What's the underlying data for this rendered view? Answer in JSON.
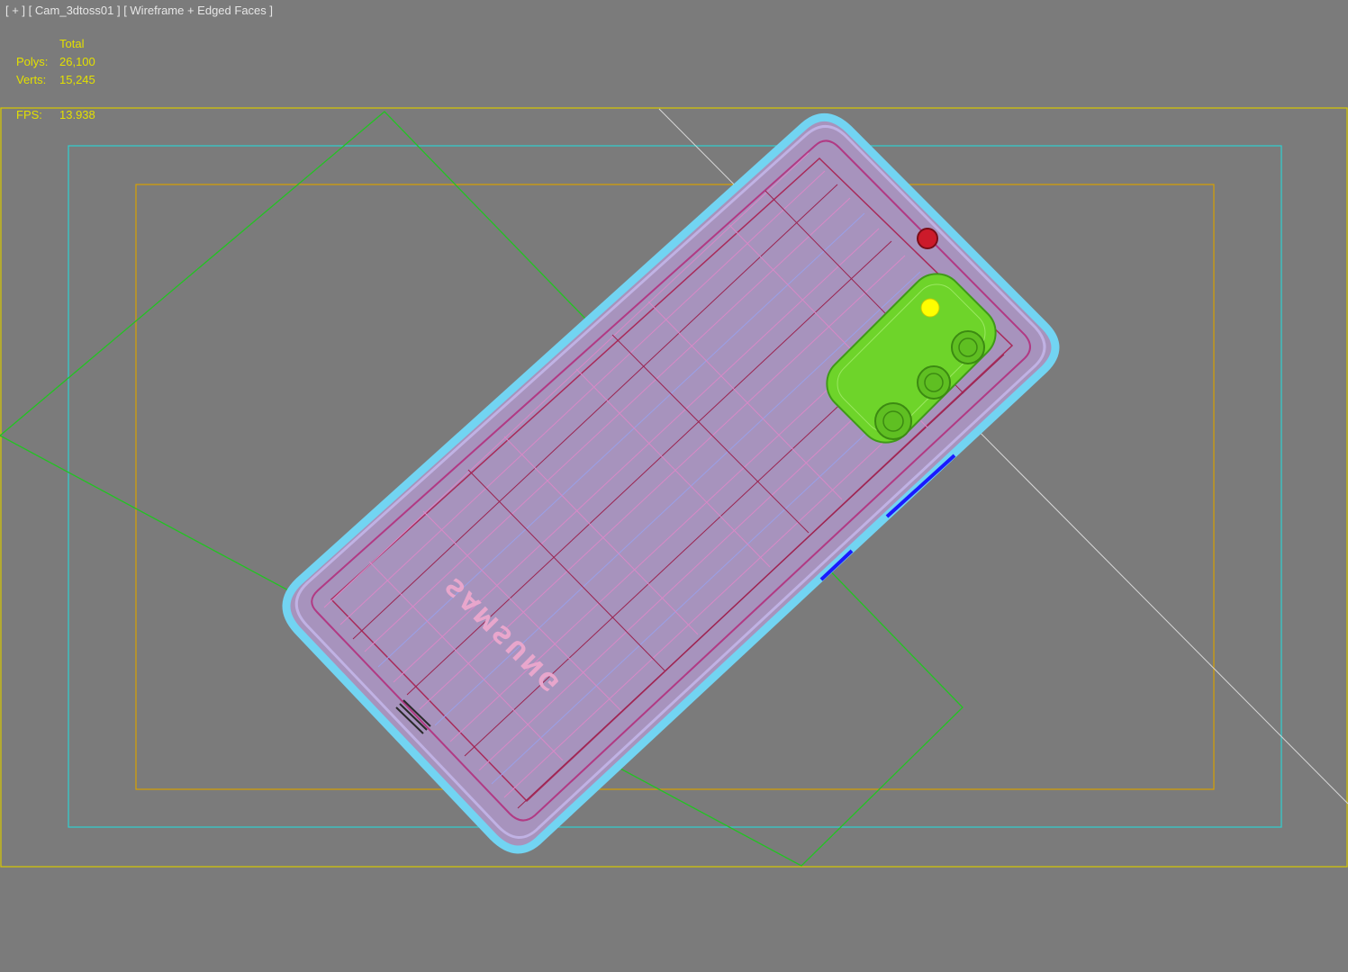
{
  "viewport_label": {
    "plus": "[ + ]",
    "camera": "[ Cam_3dtoss01 ]",
    "shading": "[ Wireframe + Edged Faces ]"
  },
  "stats": {
    "total_header": "Total",
    "polys_label": "Polys:",
    "polys_value": "26,100",
    "verts_label": "Verts:",
    "verts_value": "15,245",
    "fps_label": "FPS:",
    "fps_value": "13.938"
  },
  "model": {
    "brand_text": "SAMSUNG"
  },
  "colors": {
    "background": "#7b7b7b",
    "label_text": "#e6e6e6",
    "stats_text": "#e3e000",
    "safe_frame_outer": "#d8c800",
    "safe_frame_action": "#2fd0d0",
    "safe_frame_title": "#d8a000",
    "helper_green": "#22c422",
    "wire_cyan": "#6fd3f0",
    "wire_magenta": "#c35a9a",
    "camera_green": "#6ed42a",
    "flash_yellow": "#ffff00",
    "red_sensor": "#cc1a2a",
    "button_blue": "#1a1aff"
  }
}
